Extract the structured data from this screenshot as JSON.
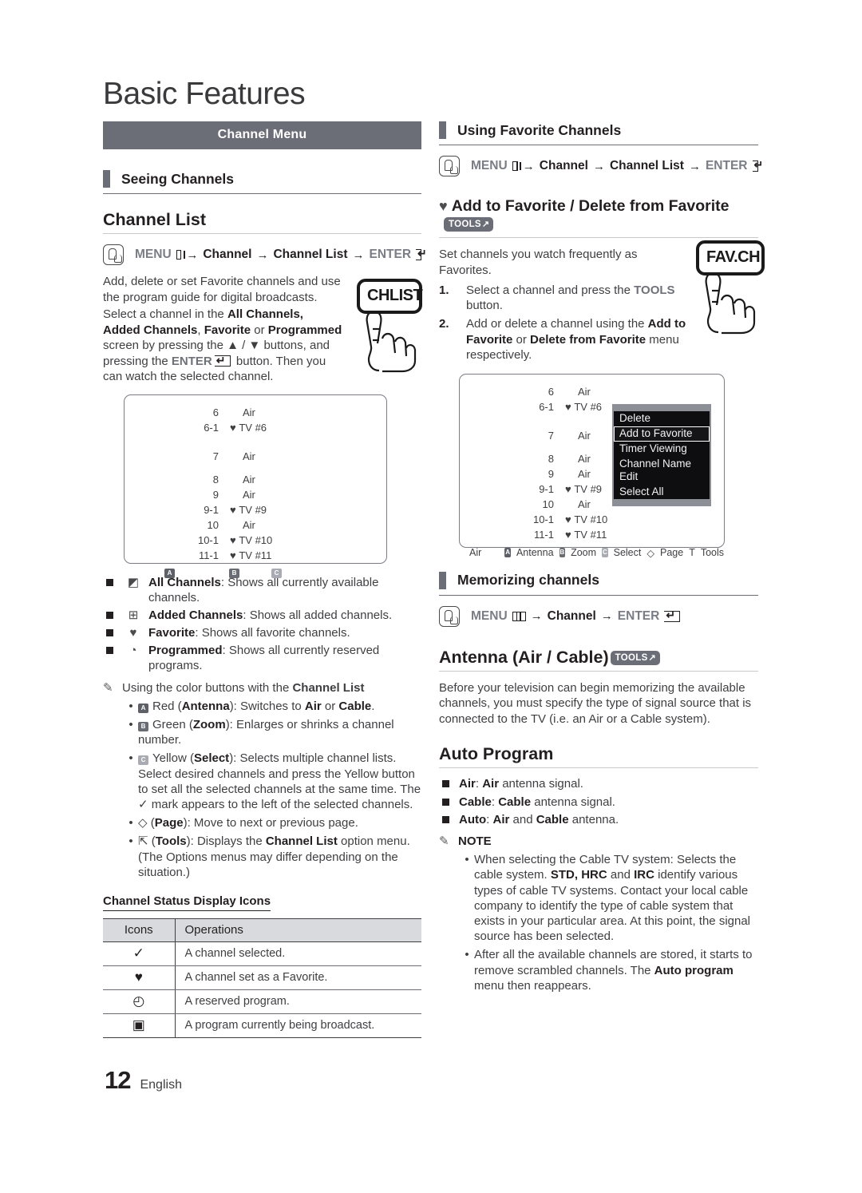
{
  "page_title": "Basic Features",
  "footer": {
    "page_number": "12",
    "language": "English"
  },
  "left": {
    "banner": "Channel Menu",
    "section_head": "Seeing Channels",
    "channel_list": {
      "heading": "Channel List",
      "path": {
        "menu": "MENU",
        "arrow": "→",
        "channel": "Channel",
        "channel_list": "Channel List",
        "enter": "ENTER"
      },
      "body_1": "Add, delete or set Favorite channels and use the program guide for digital broadcasts.",
      "body_2_a": "Select a channel in the ",
      "body_2_b": "All Channels, Added Channels",
      "body_2_c": ", ",
      "body_2_d": "Favorite",
      "body_2_e": " or ",
      "body_2_f": "Programmed",
      "body_2_g": " screen by pressing the ▲ / ▼ buttons, and pressing the ",
      "body_2_h": "ENTER",
      "body_2_i": " button. Then you can watch the selected channel.",
      "remote_key": "CHLIST"
    },
    "tv_screen": {
      "rows": [
        {
          "num": "6",
          "name": "Air",
          "fav": false
        },
        {
          "num": "6-1",
          "name": "TV #6",
          "fav": true
        },
        {
          "num": "7",
          "name": "Air",
          "fav": false
        },
        {
          "num": "8",
          "name": "Air",
          "fav": false
        },
        {
          "num": "9",
          "name": "Air",
          "fav": false
        },
        {
          "num": "9-1",
          "name": "TV #9",
          "fav": true
        },
        {
          "num": "10",
          "name": "Air",
          "fav": false
        },
        {
          "num": "10-1",
          "name": "TV #10",
          "fav": true
        },
        {
          "num": "11-1",
          "name": "TV #11",
          "fav": true
        }
      ],
      "buttons": [
        "A",
        "B",
        "C"
      ]
    },
    "bullets": [
      {
        "icon": "all-channels-icon",
        "glyph": "◩",
        "bold": "All Channels",
        "rest": ": Shows all currently available channels."
      },
      {
        "icon": "added-channels-icon",
        "glyph": "⊞",
        "bold": "Added Channels",
        "rest": ": Shows all added channels."
      },
      {
        "icon": "heart-icon",
        "glyph": "♥",
        "bold": "Favorite",
        "rest": ": Shows all favorite channels."
      },
      {
        "icon": "clock-icon",
        "glyph": "◔",
        "bold": "Programmed",
        "rest": ": Shows all currently reserved programs."
      }
    ],
    "note_color_buttons": {
      "lead": "Using the color buttons with the ",
      "bold": "Channel List"
    },
    "color_button_items": [
      {
        "key": "A",
        "key_class": "a",
        "text_1": "Red (",
        "bold_1": "Antenna",
        "text_2": "): Switches to ",
        "bold_2": "Air",
        "text_3": " or ",
        "bold_3": "Cable",
        "text_4": "."
      },
      {
        "key": "B",
        "key_class": "b",
        "text_1": "Green (",
        "bold_1": "Zoom",
        "text_2": "): Enlarges or shrinks a channel number.",
        "bold_2": "",
        "text_3": "",
        "bold_3": "",
        "text_4": ""
      },
      {
        "key": "C",
        "key_class": "c",
        "text_1": "Yellow (",
        "bold_1": "Select",
        "text_2": "): Selects multiple channel lists. Select desired channels and press the Yellow button to set all the selected channels at the same time. The ✓ mark appears to the left of the selected channels.",
        "bold_2": "",
        "text_3": "",
        "bold_3": "",
        "text_4": ""
      }
    ],
    "page_item": {
      "glyph": "◇",
      "text_1": " (",
      "bold_1": "Page",
      "text_2": "): Move to next or previous page."
    },
    "tools_item": {
      "glyph": "⇱",
      "text_1": " (",
      "bold_1": "Tools",
      "text_2": "): Displays the ",
      "bold_2": "Channel List",
      "text_3": " option menu. (The Options menus may differ depending on the situation.)"
    },
    "status_icons": {
      "subhead": "Channel Status Display Icons",
      "col_icons": "Icons",
      "col_operations": "Operations",
      "rows": [
        {
          "glyph": "✓",
          "icon_name": "check-icon",
          "operation": "A channel selected."
        },
        {
          "glyph": "♥",
          "icon_name": "heart-icon",
          "operation": "A channel set as a Favorite."
        },
        {
          "glyph": "◴",
          "icon_name": "clock-icon",
          "operation": "A reserved program."
        },
        {
          "glyph": "▣",
          "icon_name": "tv-icon",
          "operation": "A program currently being broadcast."
        }
      ]
    }
  },
  "right": {
    "section_head": "Using Favorite Channels",
    "path": {
      "menu": "MENU",
      "channel": "Channel",
      "channel_list": "Channel List",
      "enter": "ENTER"
    },
    "favorite": {
      "heading": "Add to Favorite / Delete from Favorite",
      "tools_badge": "TOOLS",
      "intro": "Set channels you watch frequently as Favorites.",
      "steps": [
        {
          "n": "1.",
          "text_1": "Select a channel and press the ",
          "bold_1": "TOOLS",
          "text_2": " button.",
          "bold_2": "",
          "text_3": ""
        },
        {
          "n": "2.",
          "text_1": "Add or delete a channel using the ",
          "bold_1": "Add to Favorite",
          "text_2": " or ",
          "bold_2": "Delete from Favorite",
          "text_3": " menu respectively."
        }
      ],
      "remote_key": "FAV.CH"
    },
    "tv_screen": {
      "rows": [
        {
          "num": "6",
          "name": "Air",
          "fav": false
        },
        {
          "num": "6-1",
          "name": "TV #6",
          "fav": true
        },
        {
          "num": "7",
          "name": "Air",
          "fav": false
        },
        {
          "num": "8",
          "name": "Air",
          "fav": false
        },
        {
          "num": "9",
          "name": "Air",
          "fav": false
        },
        {
          "num": "9-1",
          "name": "TV #9",
          "fav": true
        },
        {
          "num": "10",
          "name": "Air",
          "fav": false
        },
        {
          "num": "10-1",
          "name": "TV #10",
          "fav": true
        },
        {
          "num": "11-1",
          "name": "TV #11",
          "fav": true
        }
      ],
      "popup": {
        "items": [
          "Delete",
          "Add to Favorite",
          "Timer Viewing",
          "Channel Name Edit",
          "Select All"
        ],
        "selected_index": 1
      },
      "statusbar": {
        "source": "Air",
        "antenna": "Antenna",
        "zoom": "Zoom",
        "select": "Select",
        "page": "Page",
        "page_glyph": "◇",
        "tools_key": "T",
        "tools": "Tools"
      }
    },
    "memorizing": {
      "section_head": "Memorizing channels",
      "path": {
        "menu": "MENU",
        "channel": "Channel",
        "enter": "ENTER"
      }
    },
    "antenna": {
      "heading": "Antenna (Air / Cable)",
      "tools_badge": "TOOLS",
      "body": "Before your television can begin memorizing the available channels, you must specify the type of signal source that is connected to the TV (i.e. an Air or a Cable system)."
    },
    "auto_program": {
      "heading": "Auto Program",
      "bullets": [
        {
          "bold_1": "Air",
          "text_1": ": ",
          "bold_2": "Air",
          "text_2": " antenna signal.",
          "bold_3": "",
          "text_3": ""
        },
        {
          "bold_1": "Cable",
          "text_1": ": ",
          "bold_2": "Cable",
          "text_2": " antenna signal.",
          "bold_3": "",
          "text_3": ""
        },
        {
          "bold_1": "Auto",
          "text_1": ": ",
          "bold_2": "Air",
          "text_2": " and ",
          "bold_3": "Cable",
          "text_3": " antenna."
        }
      ],
      "note_label": "NOTE",
      "notes": [
        {
          "text_1": "When selecting the Cable TV system: Selects the cable system. ",
          "bold_1": "STD, HRC",
          "text_2": " and ",
          "bold_2": "IRC",
          "text_3": " identify various types of cable TV systems. Contact your local cable company to identify the type of cable system that exists in your particular area. At this point, the signal source has been selected."
        },
        {
          "text_1": "After all the available channels are stored, it starts to remove scrambled channels. The ",
          "bold_1": "Auto program",
          "text_2": " menu then reappears.",
          "bold_2": "",
          "text_3": ""
        }
      ]
    }
  }
}
